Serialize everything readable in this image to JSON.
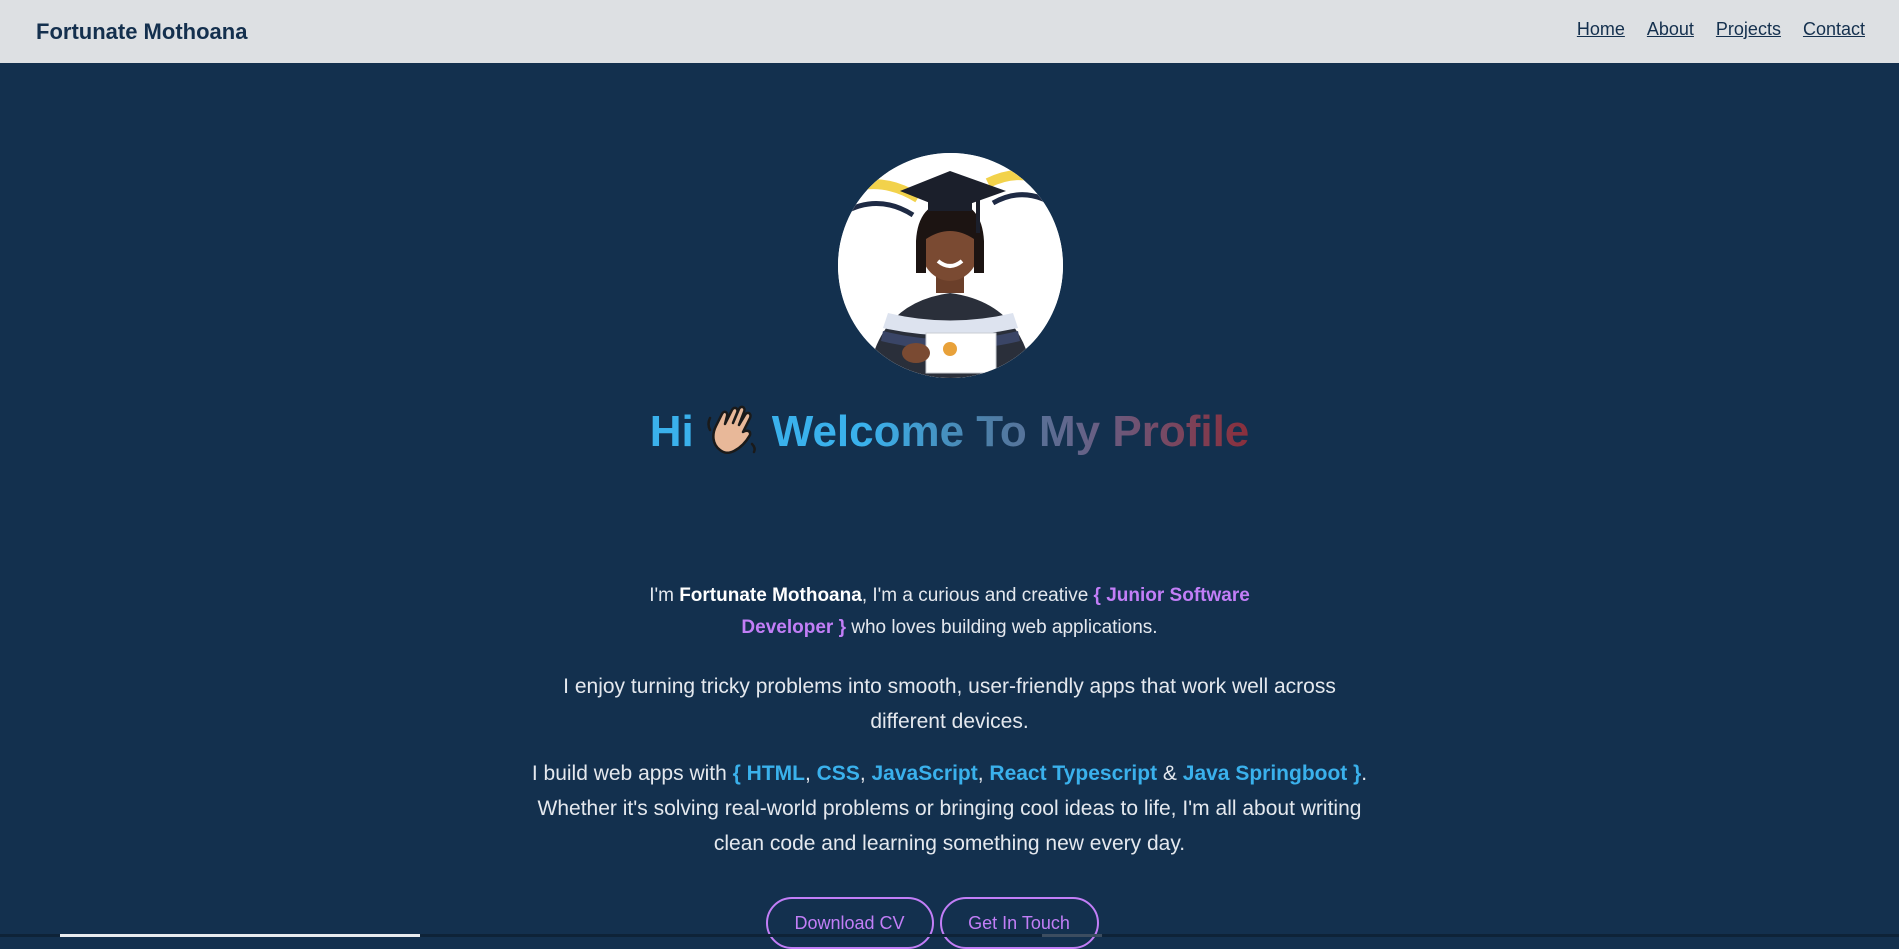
{
  "navbar": {
    "brand": "Fortunate Mothoana",
    "links": [
      {
        "label": "Home"
      },
      {
        "label": "About"
      },
      {
        "label": "Projects"
      },
      {
        "label": "Contact"
      }
    ]
  },
  "hero": {
    "greeting": "Hi",
    "wave_icon": "waving-hand-icon",
    "headline": "Welcome To My Profile",
    "intro": {
      "prefix": "I'm ",
      "name": "Fortunate Mothoana",
      "middle": ", I'm a curious and creative ",
      "role_line1": "{ Junior Software",
      "role_line2": "Developer }",
      "suffix": " who loves building web applications."
    },
    "paragraph2_line1": "I enjoy turning tricky problems into smooth, user-friendly apps that work well across",
    "paragraph2_line2": "different devices.",
    "paragraph3": {
      "prefix": "I build web apps with ",
      "tech1": "{ HTML",
      "sep1": ", ",
      "tech2": "CSS",
      "sep2": ", ",
      "tech3": "JavaScript",
      "sep3": ", ",
      "tech4": "React Typescript",
      "amp": " & ",
      "tech5": "Java Springboot }",
      "end": ".",
      "line2": "Whether it's solving real-world problems or bringing cool ideas to life, I'm all about writing",
      "line3": "clean code and learning something new every day."
    },
    "buttons": {
      "download_cv": "Download CV",
      "get_in_touch": "Get In Touch"
    }
  },
  "colors": {
    "nav_bg": "#dde0e3",
    "page_bg": "#13304e",
    "accent_blue": "#3ab1ec",
    "accent_purple": "#c27ef7",
    "brand_text": "#14304e"
  }
}
